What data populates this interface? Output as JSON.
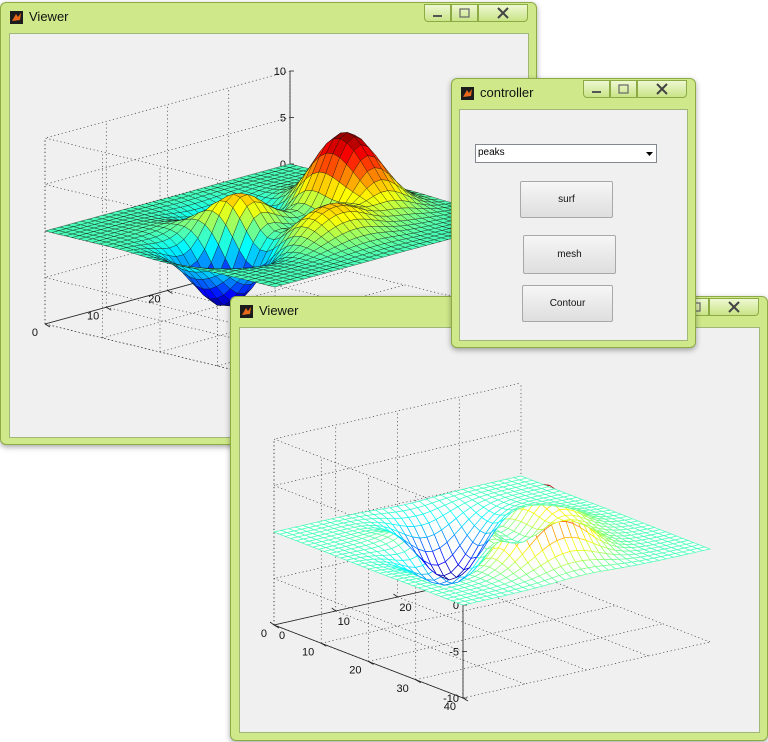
{
  "viewer_back": {
    "title": "Viewer",
    "render_style": "surf"
  },
  "viewer_front": {
    "title": "Viewer",
    "render_style": "mesh"
  },
  "controller": {
    "title": "controller",
    "function_select": {
      "value": "peaks"
    },
    "buttons": {
      "surf": "surf",
      "mesh": "mesh",
      "contour": "Contour"
    }
  },
  "chart_data": [
    {
      "type": "surface",
      "function": "peaks",
      "style": "surf",
      "zlim": [
        -10,
        10
      ],
      "z_ticks": [
        "10",
        "5",
        "0",
        "-5",
        "-10"
      ],
      "y_ticks": [
        "40",
        "30",
        "20",
        "10",
        "0"
      ],
      "x_ticks": [],
      "grid": true,
      "colormap": "jet"
    },
    {
      "type": "surface",
      "function": "peaks",
      "style": "mesh",
      "zlim": [
        -10,
        10
      ],
      "z_ticks": [
        "10",
        "5",
        "0",
        "-5",
        "-10"
      ],
      "y_ticks": [
        "40",
        "30",
        "20",
        "10",
        "0"
      ],
      "x_ticks": [
        "0",
        "10",
        "20",
        "30",
        "40"
      ],
      "grid": true,
      "colormap": "jet"
    }
  ],
  "colors": {
    "window_frame": "#cfe98a",
    "client_bg": "#f0f0f0"
  },
  "icons": {
    "app": "matlab-icon",
    "minimize": "minimize-icon",
    "maximize": "maximize-icon",
    "close": "close-icon",
    "dropdown": "chevron-down-icon"
  }
}
